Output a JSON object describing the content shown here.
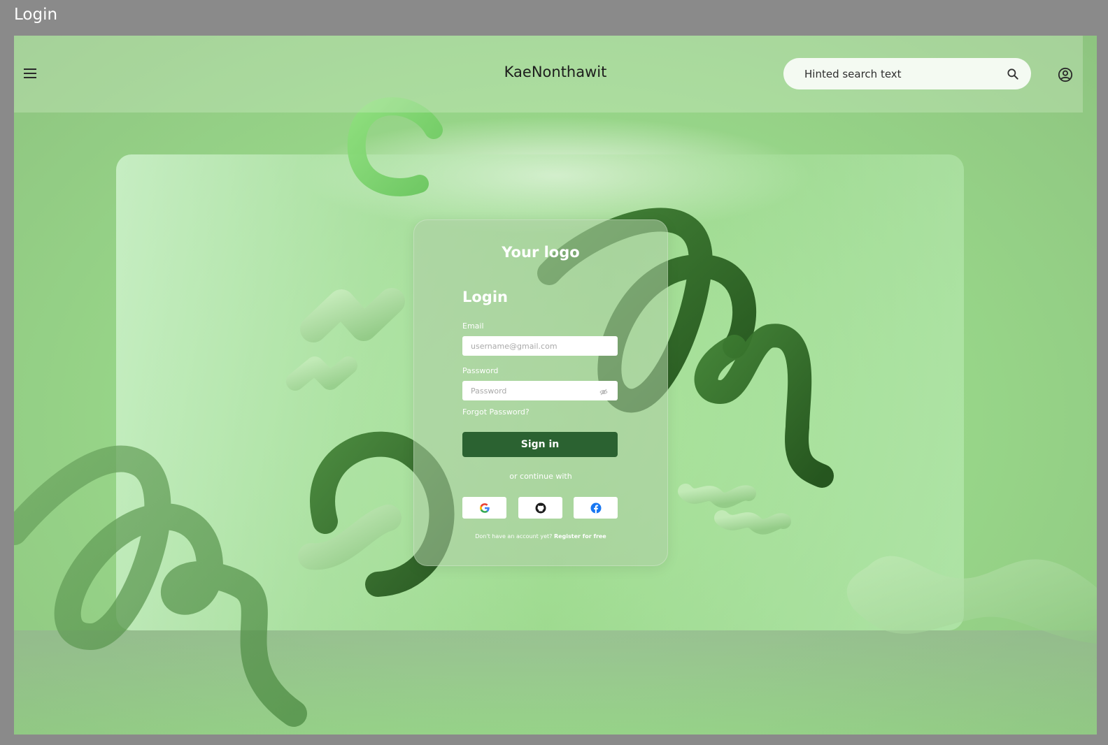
{
  "window": {
    "title": "Login"
  },
  "header": {
    "brand": "KaeNonthawit",
    "search": {
      "placeholder": "Hinted search text"
    },
    "icons": {
      "menu": "menu-icon",
      "search": "search-icon",
      "account": "account-circle-icon"
    }
  },
  "login": {
    "logo": "Your logo",
    "heading": "Login",
    "email_label": "Email",
    "email_placeholder": "username@gmail.com",
    "password_label": "Password",
    "password_placeholder": "Password",
    "forgot": "Forgot Password?",
    "sign_in": "Sign in",
    "or_continue": "or continue with",
    "social": [
      "google-icon",
      "github-icon",
      "facebook-icon"
    ],
    "no_account": "Don't have an account yet?",
    "register": "Register for free"
  },
  "colors": {
    "background": "#97d588",
    "primary_button": "#2b6231",
    "dark_shape": "#2f6a25"
  }
}
